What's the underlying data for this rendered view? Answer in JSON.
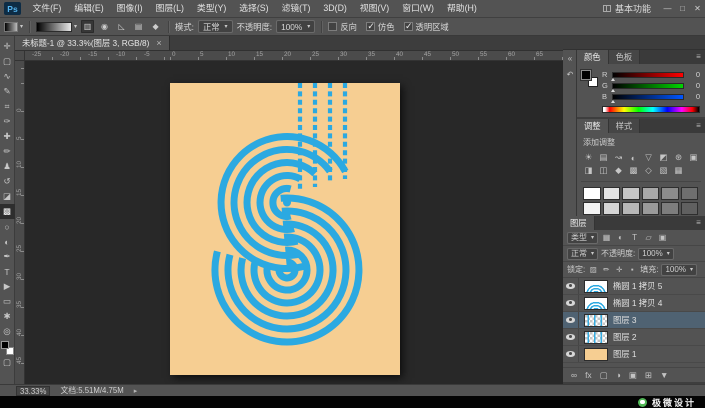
{
  "ui": {
    "panel_menu": "≡",
    "caret": "▾",
    "collapse": "«",
    "history": "↶",
    "status_arrow": "▸"
  },
  "menu_bar": {
    "logo": "Ps",
    "items": [
      "文件(F)",
      "编辑(E)",
      "图像(I)",
      "图层(L)",
      "类型(Y)",
      "选择(S)",
      "滤镜(T)",
      "3D(D)",
      "视图(V)",
      "窗口(W)",
      "帮助(H)"
    ],
    "workspace": "基本功能",
    "minimize": "—",
    "restore": "□",
    "close": "✕"
  },
  "options_bar": {
    "gradient_types": [
      "▥",
      "◉",
      "◺",
      "▤",
      "◆"
    ],
    "mode_label": "模式:",
    "mode_value": "正常",
    "opacity_label": "不透明度:",
    "opacity_value": "100%",
    "checkboxes": [
      {
        "label": "反向",
        "checked": false
      },
      {
        "label": "仿色",
        "checked": true
      },
      {
        "label": "透明区域",
        "checked": true
      }
    ]
  },
  "toolbar": {
    "glyphs": [
      "✛",
      "▢",
      "∿",
      "✎",
      "⌗",
      "✑",
      "✚",
      "✏",
      "♟",
      "↺",
      "◪",
      "▩",
      "○",
      "◐",
      "✒",
      "T",
      "▶",
      "▭",
      "✱",
      "◎"
    ]
  },
  "document": {
    "tab_title": "未标题-1 @ 33.3%(图层 3, RGB/8)",
    "close_label": "×",
    "bg_color": "#F6CE92",
    "art_color": "#2BA9E1"
  },
  "rulers": {
    "h": [
      "-25",
      "-20",
      "-15",
      "-10",
      "-5",
      "0",
      "5",
      "10",
      "15",
      "20",
      "25",
      "30",
      "35",
      "40",
      "45",
      "50",
      "55",
      "60",
      "65"
    ],
    "v": [
      "0",
      "5",
      "10",
      "15",
      "20",
      "25",
      "30",
      "35",
      "40",
      "45",
      "50"
    ]
  },
  "color_panel": {
    "tab_color": "颜色",
    "tab_swatches": "色板",
    "channels": [
      {
        "label": "R",
        "value": "0"
      },
      {
        "label": "G",
        "value": "0"
      },
      {
        "label": "B",
        "value": "0"
      }
    ]
  },
  "adjustments_panel": {
    "tab_adjustments": "调整",
    "tab_styles": "样式",
    "add_label": "添加调整",
    "icons": [
      "☀",
      "▤",
      "↝",
      "◐",
      "▽",
      "◩",
      "⊛",
      "▣",
      "◨",
      "◫",
      "◆",
      "▩",
      "◇",
      "▧",
      "▦"
    ],
    "style_swatches": [
      "#ffffff",
      "#e3e3e3",
      "#c6c6c6",
      "#a9a9a9",
      "#8c8c8c",
      "#6f6f6f",
      "#f4f4f4",
      "#d5d5d5",
      "#b7b7b7",
      "#9a9a9a",
      "#7d7d7d",
      "#606060"
    ]
  },
  "layers_panel": {
    "tab": "图层",
    "filter_label": "类型",
    "filter_icons": [
      "▦",
      "◐",
      "T",
      "▱",
      "▣"
    ],
    "blend_mode": "正常",
    "opacity_label": "不透明度:",
    "opacity_value": "100%",
    "lock_label": "锁定:",
    "lock_icons": [
      "▨",
      "✏",
      "✛",
      "▪"
    ],
    "fill_label": "填充:",
    "fill_value": "100%",
    "layers": [
      {
        "name": "椭圆 1 拷贝 5",
        "thumb": "rings",
        "selected": false
      },
      {
        "name": "椭圆 1 拷贝 4",
        "thumb": "rings",
        "selected": false
      },
      {
        "name": "图层 3",
        "thumb": "dashes",
        "selected": true
      },
      {
        "name": "图层 2",
        "thumb": "dashes",
        "selected": false
      },
      {
        "name": "图层 1",
        "thumb": "orange",
        "selected": false
      }
    ],
    "bottom_icons": [
      "∞",
      "fx",
      "▢",
      "◑",
      "▣",
      "⊞",
      "▼"
    ]
  },
  "status_bar": {
    "zoom": "33.33%",
    "doc_info": "文档:5.51M/4.75M"
  },
  "brand": {
    "text": "极微设计"
  }
}
